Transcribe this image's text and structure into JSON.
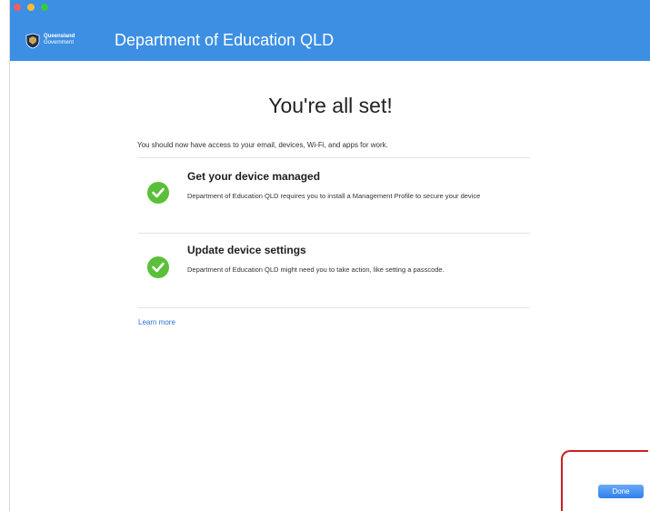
{
  "header": {
    "logo_line1": "Queensland",
    "logo_line2": "Government",
    "title": "Department of Education QLD"
  },
  "main": {
    "heading": "You're all set!",
    "subtext": "You should now have access to your email, devices, Wi-Fi, and apps for work.",
    "items": [
      {
        "title": "Get your device managed",
        "description": "Department of Education QLD requires you to install a Management Profile to secure your device",
        "icon": "check-circle-icon"
      },
      {
        "title": "Update device settings",
        "description": "Department of Education QLD might need you to take action, like setting a passcode.",
        "icon": "check-circle-icon"
      }
    ],
    "learn_more": "Learn more"
  },
  "footer": {
    "done_label": "Done"
  },
  "colors": {
    "header_bg": "#3c8fe3",
    "check_green": "#5bbf3a",
    "link_blue": "#2f6fd6",
    "highlight_red": "#cc1f1f"
  }
}
